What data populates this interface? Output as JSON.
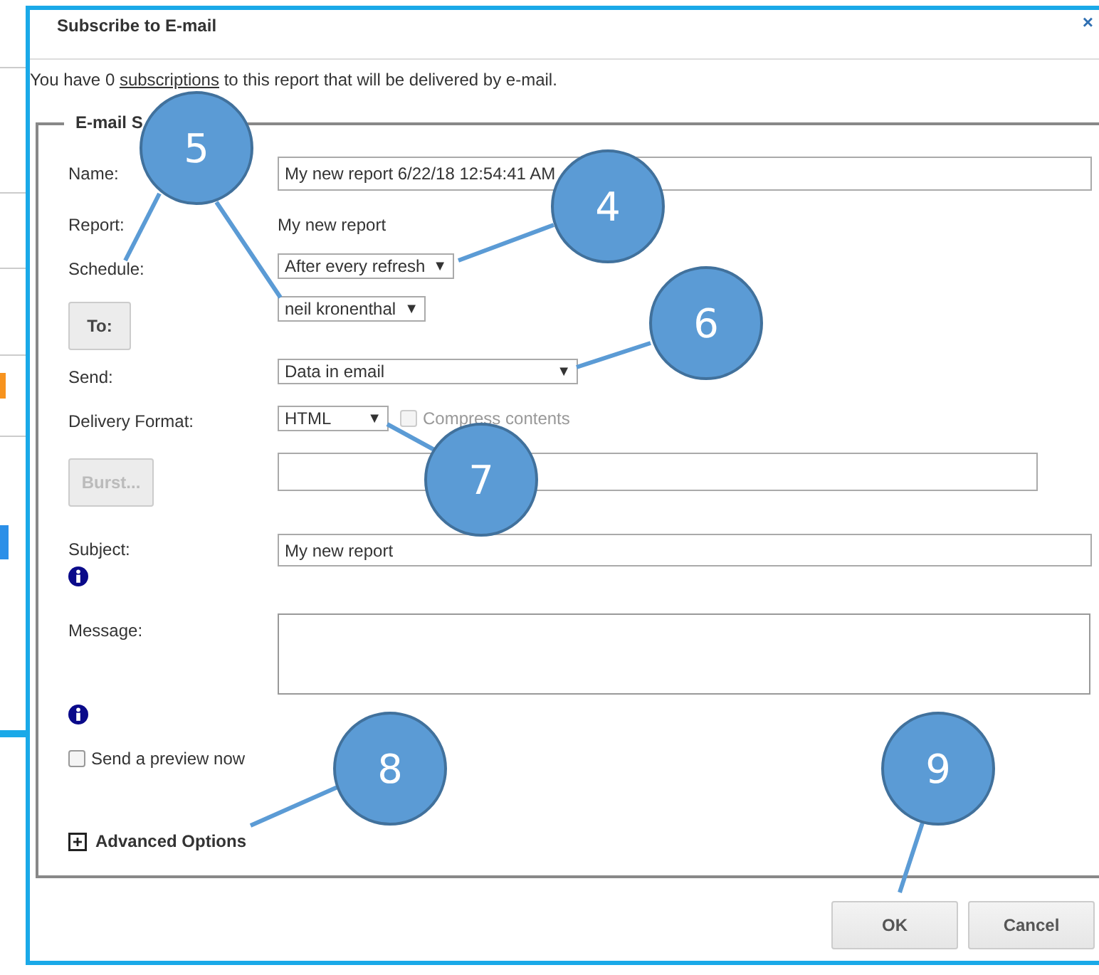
{
  "dialog": {
    "title": "Subscribe to E-mail",
    "close": "×"
  },
  "intro": {
    "before": "You have 0 ",
    "link": "subscriptions",
    "after": " to this report that will be delivered by e-mail."
  },
  "section": {
    "legend": "E-mail S"
  },
  "name": {
    "label": "Name:",
    "value": "My new report 6/22/18 12:54:41 AM"
  },
  "report": {
    "label": "Report:",
    "value": "My new report"
  },
  "schedule": {
    "label": "Schedule:",
    "value": "After every refresh",
    "arrow": "▼"
  },
  "recipient": {
    "button": "To:",
    "value": "neil kronenthal",
    "arrow": "▼"
  },
  "send": {
    "label": "Send:",
    "value": "Data in email",
    "arrow": "▼"
  },
  "delivery_format": {
    "label": "Delivery Format:",
    "value": "HTML",
    "arrow": "▼",
    "compress": {
      "label": "Compress contents",
      "checked": false,
      "disabled": true
    }
  },
  "burst": {
    "button": "Burst...",
    "disabled": true
  },
  "subject": {
    "label": "Subject:",
    "value": "My new report"
  },
  "message": {
    "label": "Message:"
  },
  "preview": {
    "label": "Send a preview now",
    "checked": false
  },
  "advanced": {
    "label": "Advanced Options",
    "expanded": false
  },
  "buttons": [
    {
      "label": "OK"
    },
    {
      "label": "Cancel"
    }
  ],
  "callouts": [
    {
      "number": "5"
    },
    {
      "number": "4"
    },
    {
      "number": "6"
    },
    {
      "number": "7"
    },
    {
      "number": "8"
    },
    {
      "number": "9"
    }
  ]
}
